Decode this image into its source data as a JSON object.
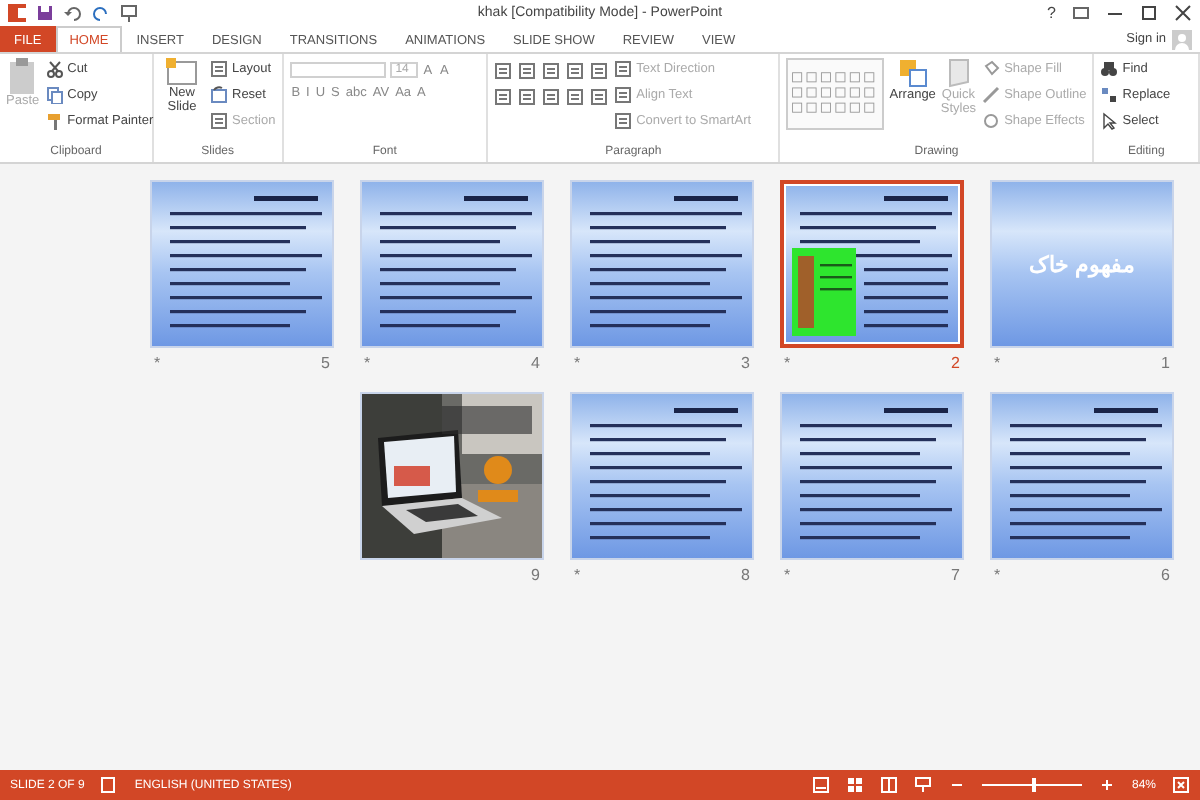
{
  "window": {
    "title": "khak [Compatibility Mode] - PowerPoint",
    "help": "?",
    "sign_in": "Sign in"
  },
  "tabs": [
    {
      "label": "FILE",
      "kind": "file",
      "selected": false
    },
    {
      "label": "HOME",
      "kind": "tab",
      "selected": true
    },
    {
      "label": "INSERT",
      "kind": "tab",
      "selected": false
    },
    {
      "label": "DESIGN",
      "kind": "tab",
      "selected": false
    },
    {
      "label": "TRANSITIONS",
      "kind": "tab",
      "selected": false
    },
    {
      "label": "ANIMATIONS",
      "kind": "tab",
      "selected": false
    },
    {
      "label": "SLIDE SHOW",
      "kind": "tab",
      "selected": false
    },
    {
      "label": "REVIEW",
      "kind": "tab",
      "selected": false
    },
    {
      "label": "VIEW",
      "kind": "tab",
      "selected": false
    }
  ],
  "ribbon": {
    "clipboard": {
      "label": "Clipboard",
      "paste": {
        "label": "Paste",
        "disabled": true
      },
      "items": [
        {
          "label": "Cut",
          "disabled": false
        },
        {
          "label": "Copy",
          "disabled": false
        },
        {
          "label": "Format Painter",
          "disabled": false
        }
      ]
    },
    "slides": {
      "label": "Slides",
      "new_slide": {
        "label": "New Slide"
      },
      "items": [
        {
          "label": "Layout",
          "disabled": false
        },
        {
          "label": "Reset",
          "disabled": false
        },
        {
          "label": "Section",
          "disabled": true
        }
      ]
    },
    "font": {
      "label": "Font",
      "size": "14",
      "row1": [
        "A",
        "A"
      ],
      "row2": [
        "B",
        "I",
        "U",
        "S",
        "abc",
        "AV",
        "Aa",
        "A"
      ]
    },
    "paragraph": {
      "label": "Paragraph",
      "items": [
        {
          "label": "Text Direction",
          "disabled": true
        },
        {
          "label": "Align Text",
          "disabled": true
        },
        {
          "label": "Convert to SmartArt",
          "disabled": true
        }
      ]
    },
    "drawing": {
      "label": "Drawing",
      "arrange": "Arrange",
      "quick_styles": "Quick Styles",
      "items": [
        {
          "label": "Shape Fill",
          "disabled": true
        },
        {
          "label": "Shape Outline",
          "disabled": true
        },
        {
          "label": "Shape Effects",
          "disabled": true
        }
      ]
    },
    "editing": {
      "label": "Editing",
      "items": [
        {
          "label": "Find",
          "disabled": false
        },
        {
          "label": "Replace",
          "disabled": false
        },
        {
          "label": "Select",
          "disabled": false
        }
      ]
    }
  },
  "slides": [
    {
      "number": "5",
      "kind": "text",
      "mark": "*",
      "selected": false
    },
    {
      "number": "4",
      "kind": "text",
      "mark": "*",
      "selected": false
    },
    {
      "number": "3",
      "kind": "text",
      "mark": "*",
      "selected": false
    },
    {
      "number": "2",
      "kind": "text-image",
      "mark": "*",
      "selected": true
    },
    {
      "number": "1",
      "kind": "title",
      "title": "مفهوم خاک",
      "mark": "*",
      "selected": false
    },
    {
      "number": "9",
      "kind": "picture",
      "selected": false
    },
    {
      "number": "8",
      "kind": "text",
      "mark": "*",
      "selected": false
    },
    {
      "number": "7",
      "kind": "text",
      "mark": "*",
      "selected": false
    },
    {
      "number": "6",
      "kind": "text",
      "mark": "*",
      "selected": false
    }
  ],
  "status_bar": {
    "slide": "SLIDE 2 OF 9",
    "language": "ENGLISH (UNITED STATES)",
    "zoom": "84%",
    "zoom_slider": {
      "level": 0.5
    }
  }
}
